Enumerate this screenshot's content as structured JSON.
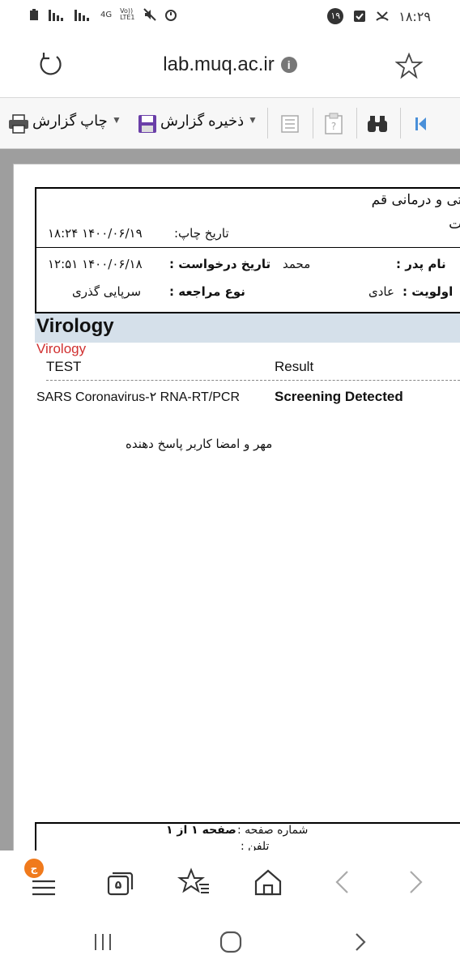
{
  "status_bar": {
    "time": "۱۸:۲۹",
    "network": "4G",
    "network_sub": "Vo))\nLTE1",
    "notification_count": "۱۹"
  },
  "address_bar": {
    "url": "lab.muq.ac.ir"
  },
  "toolbar": {
    "print_label": "چاپ گزارش",
    "save_label": "ذخیره گزارش"
  },
  "report": {
    "org_line1": "شتی و درمانی قم",
    "org_line2": "شت",
    "print_date_label": "تاریخ چاپ:",
    "print_date_value": "۱۴۰۰/۰۶/۱۹ ۱۸:۲۴",
    "father_name_label": "نام پدر :",
    "father_name_value": "محمد",
    "request_date_label": "تاریخ درخواست :",
    "request_date_value": "۱۴۰۰/۰۶/۱۸ ۱۲:۵۱",
    "priority_label": "اولویت :",
    "priority_value": "عادی",
    "visit_type_label": "نوع مراجعه :",
    "visit_type_value": "سرپایی گذری",
    "section_title": "Virology",
    "section_subtitle": "Virology",
    "col_test": "TEST",
    "col_result": "Result",
    "rows": [
      {
        "test": "SARS Coronavirus-۲ RNA-RT/PCR",
        "result": "Screening Detected"
      }
    ],
    "signature_text": "مهر و امضا کاربر پاسخ دهنده",
    "page_number_label": "شماره صفحه :",
    "page_number_value": "صفحه ۱ از ۱",
    "phone_label": "تلفن :"
  },
  "bottom_nav": {
    "badge": "ج",
    "tabs_count": "۵"
  }
}
